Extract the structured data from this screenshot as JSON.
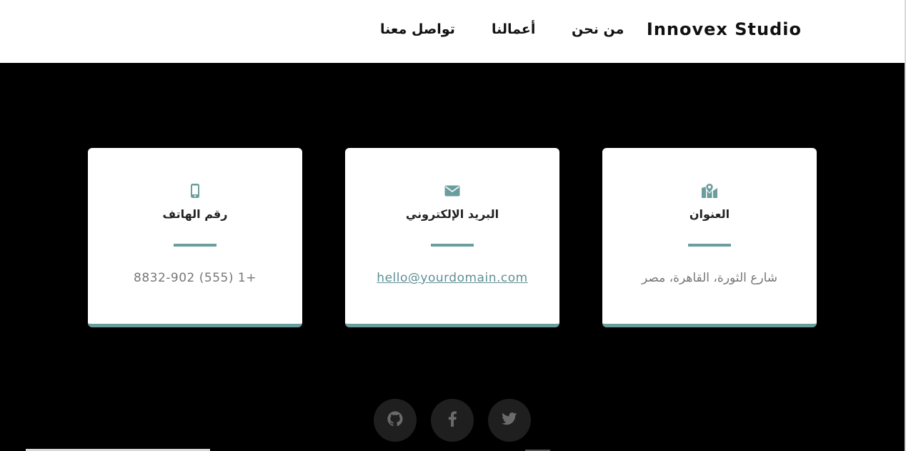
{
  "header": {
    "brand": "Innovex Studio",
    "nav": {
      "about": "من نحن",
      "work": "أعمالنا",
      "contact": "تواصل معنا"
    }
  },
  "contact_cards": {
    "phone": {
      "icon": "mobile-phone-icon",
      "title": "رقم الهاتف",
      "value": "+1 (555) 8832-902"
    },
    "email": {
      "icon": "envelope-icon",
      "title": "البريد الإلكتروني",
      "value": "hello@yourdomain.com"
    },
    "address": {
      "icon": "map-marker-icon",
      "title": "العنوان",
      "value": "شارع الثورة، القاهرة، مصر"
    }
  },
  "social": [
    "github-icon",
    "facebook-icon",
    "twitter-icon"
  ],
  "colors": {
    "accent": "#6a9e9c",
    "background": "#000000",
    "card": "#ffffff",
    "social_bg": "#1f1f1f",
    "social_icon": "#6b6b6b",
    "muted_text": "#777777",
    "link": "#5f8f95"
  }
}
